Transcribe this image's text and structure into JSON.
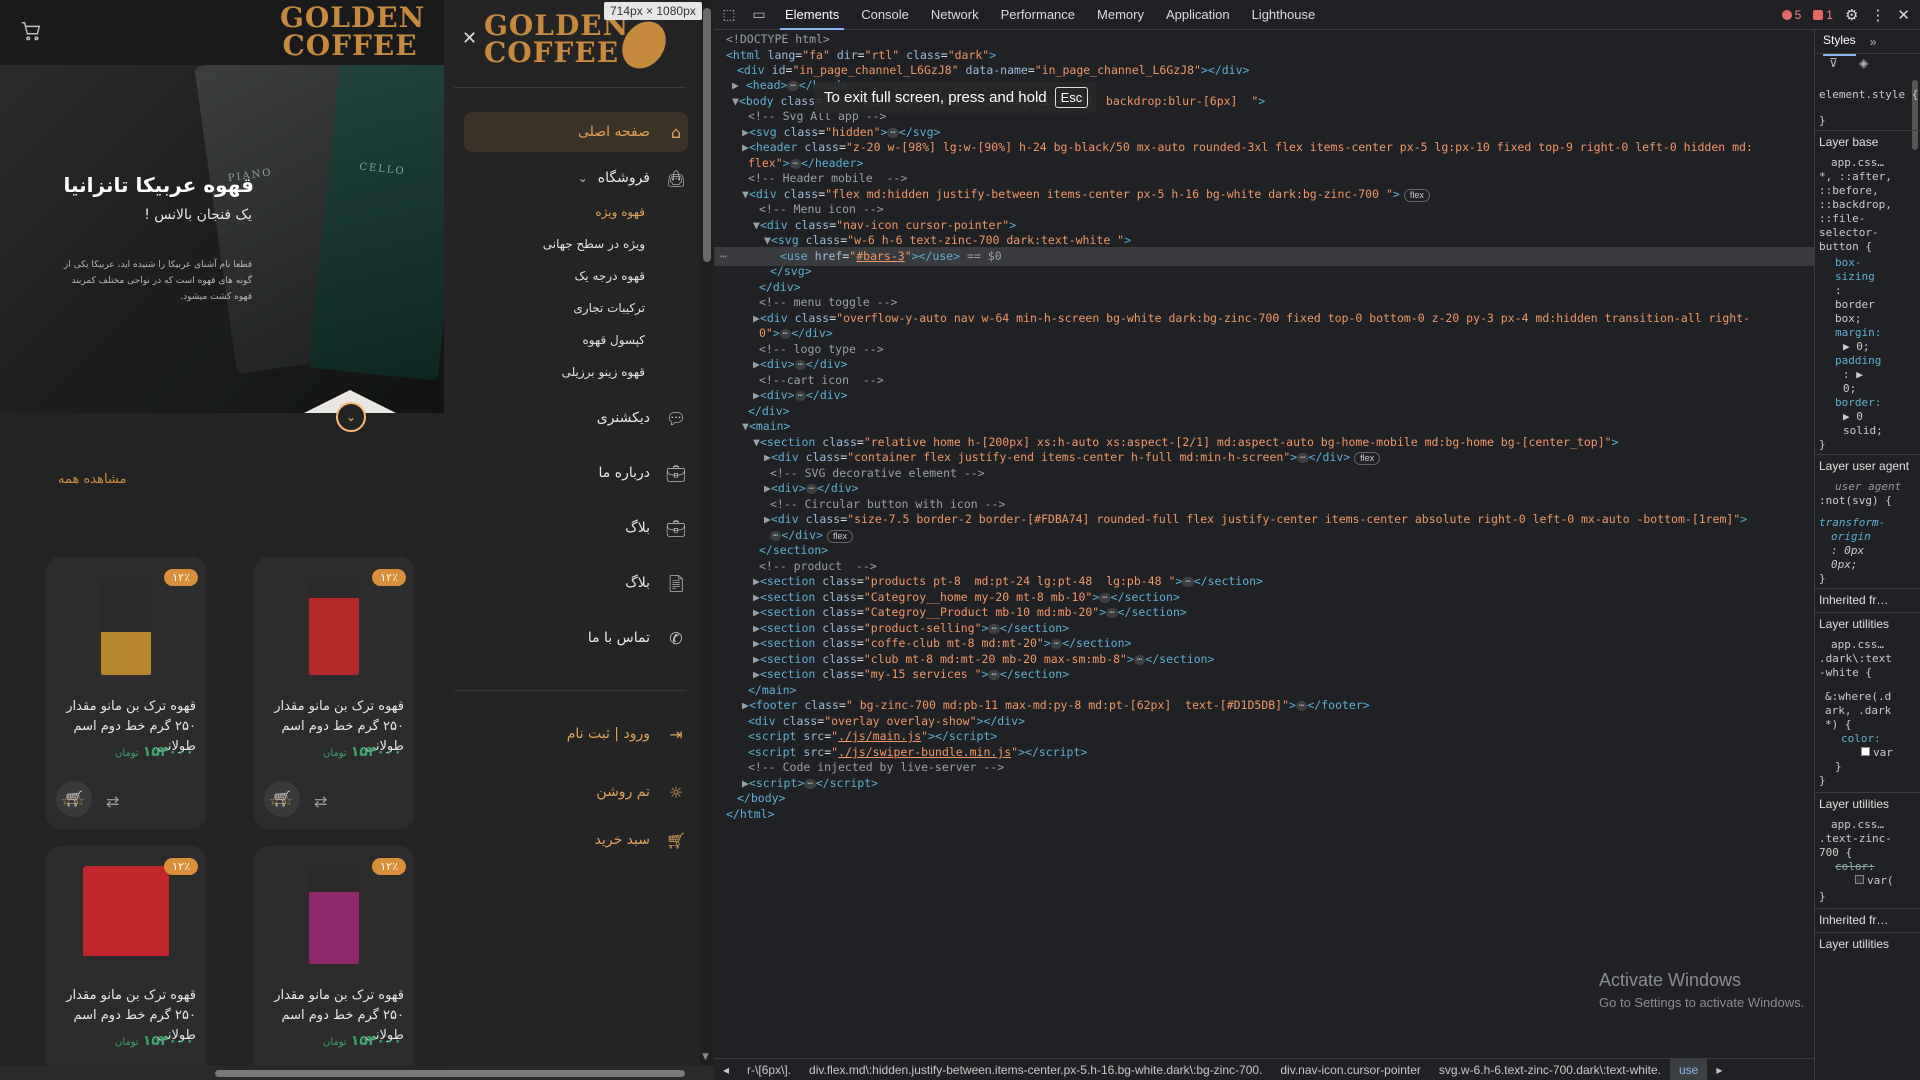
{
  "site": {
    "logo_text": "GOLDEN\nCOFFEE",
    "hero": {
      "title": "قهوه عربیکا تانزانیا",
      "subtitle": "یک فنجان بالانس !",
      "description": "قطعا نام آشنای عربیکا را شنیده اید، عربیکا یکی از گونه های قهوه است که در نواحی مختلف کمربند قهوه کشت میشود.",
      "bag_labels": [
        "PIANO",
        "CELLO"
      ]
    },
    "see_all": "مشاهده همه",
    "products": [
      {
        "badge": "۱۲٪",
        "title": "قهوه ترک بن مانو مقدار ۲۵۰ گرم خط دوم اسم طولانی",
        "price": "۱۵۴۰۰۰",
        "currency": "تومان",
        "stars": "☆☆",
        "color": "#b8862e"
      },
      {
        "badge": "۱۲٪",
        "title": "قهوه ترک بن مانو مقدار ۲۵۰ گرم خط دوم اسم طولانی",
        "price": "۱۵۴۰۰۰",
        "currency": "تومان",
        "stars": "☆☆",
        "color": "#b42a2a"
      },
      {
        "badge": "۱۲٪",
        "title": "قهوه ترک بن مانو مقدار ۲۵۰ گرم خط دوم اسم طولانی",
        "price": "۱۵۴۰۰۰",
        "currency": "تومان",
        "stars": "",
        "color": "#c0262b"
      },
      {
        "badge": "۱۲٪",
        "title": "قهوه ترک بن مانو مقدار ۲۵۰ گرم خط دوم اسم طولانی",
        "price": "۱۵۴۰۰۰",
        "currency": "تومان",
        "stars": "",
        "color": "#8e2a6b"
      }
    ],
    "drawer": {
      "logo_text": "GOLDEN\nCOFFEE",
      "home": "صفحه اصلی",
      "shop": "فروشگاه",
      "shop_sub": [
        "قهوه ویژه",
        "ویژه در سطح جهانی",
        "قهوه درجه یک",
        "ترکیبات تجاری",
        "کپسول قهوه",
        "قهوه زینو برزیلی"
      ],
      "dictionary": "دیکشنری",
      "about": "درباره ما",
      "blog1": "بلاگ",
      "blog2": "بلاگ",
      "contact": "تماس با ما",
      "login": "ورود | ثبت نام",
      "theme": "تم روشن",
      "basket": "سبد خرید"
    },
    "dimensions_badge": "714px × 1080px"
  },
  "devtools": {
    "tabs": [
      "Elements",
      "Console",
      "Network",
      "Performance",
      "Memory",
      "Application",
      "Lighthouse"
    ],
    "active_tab": "Elements",
    "errors_count": "5",
    "issues_count": "1",
    "fullscreen_toast": "To exit full screen, press and hold",
    "esc_key": "Esc",
    "styles_tab": "Styles",
    "activate_title": "Activate Windows",
    "activate_sub": "Go to Settings to activate Windows.",
    "breadcrumbs": [
      "r-\\[6px\\].",
      "div.flex.md\\:hidden.justify-between.items-center.px-5.h-16.bg-white.dark\\:bg-zinc-700.",
      "div.nav-icon.cursor-pointer",
      "svg.w-6.h-6.text-zinc-700.dark\\:text-white.",
      "use"
    ],
    "styles_lines": [
      "element.style {",
      "}",
      "app.css…",
      "*, ::after,",
      "::before,",
      "::backdrop,",
      "::file-",
      "selector-",
      "button {",
      "box-",
      "sizing",
      ":",
      "border",
      "box;",
      "margin:",
      "▶ 0;",
      "padding",
      ": ▶",
      "0;",
      "border:",
      "▶ 0",
      "solid;",
      "}",
      "user agent",
      ":not(svg) {",
      "transform-",
      "origin",
      ": 0px",
      "0px;",
      "}",
      "app.css…",
      ".dark\\:text",
      "-white {",
      "&:where(.d",
      "ark, .dark",
      "*) {",
      "color:",
      "var",
      "}",
      "}",
      "app.css…",
      ".text-zinc-",
      "700 {",
      "color:",
      "var(",
      "}"
    ],
    "styles_sections": [
      "Layer base",
      "Layer user agent",
      "Inherited fr…",
      "Layer utilities",
      "Layer utilities",
      "Inherited fr…",
      "Layer utilities"
    ]
  }
}
